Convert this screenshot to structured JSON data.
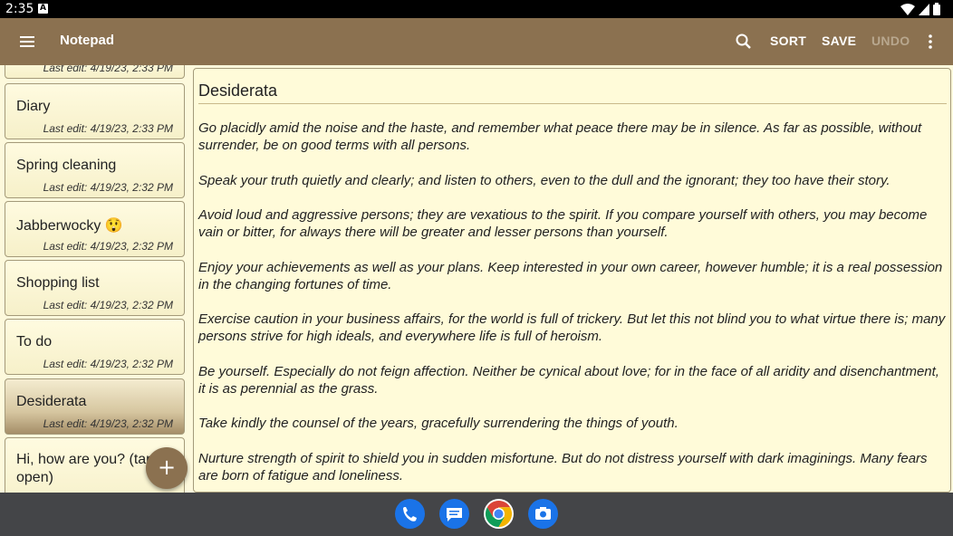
{
  "status_bar": {
    "time": "2:35",
    "indicator": "A"
  },
  "app_bar": {
    "title": "Notepad",
    "actions": {
      "sort": "SORT",
      "save": "SAVE",
      "undo": "UNDO"
    },
    "icons": [
      "menu-icon",
      "search-icon",
      "overflow-menu-icon"
    ]
  },
  "note_list": {
    "top_partial_date": "Last edit: 4/19/23, 2:33 PM",
    "items": [
      {
        "title": "Diary",
        "date": "Last edit: 4/19/23, 2:33 PM",
        "selected": false
      },
      {
        "title": "Spring cleaning",
        "date": "Last edit: 4/19/23, 2:32 PM",
        "selected": false
      },
      {
        "title": "Jabberwocky 😲",
        "date": "Last edit: 4/19/23, 2:32 PM",
        "selected": false
      },
      {
        "title": "Shopping list",
        "date": "Last edit: 4/19/23, 2:32 PM",
        "selected": false
      },
      {
        "title": "To do",
        "date": "Last edit: 4/19/23, 2:32 PM",
        "selected": false
      },
      {
        "title": "Desiderata",
        "date": "Last edit: 4/19/23, 2:32 PM",
        "selected": true
      },
      {
        "title": "Hi, how are you? (tap to open)",
        "date": "",
        "selected": false
      }
    ]
  },
  "fab": {
    "label": "+"
  },
  "editor": {
    "title": "Desiderata",
    "paragraphs": [
      "Go placidly amid the noise and the haste, and remember what peace there may be in silence. As far as possible, without surrender, be on good terms with all persons.",
      "Speak your truth quietly and clearly; and listen to others, even to the dull and the ignorant; they too have their story.",
      "Avoid loud and aggressive persons; they are vexatious to the spirit. If you compare yourself with others, you may become vain or bitter, for always there will be greater and lesser persons than yourself.",
      "Enjoy your achievements as well as your plans. Keep interested in your own career, however humble; it is a real possession in the changing fortunes of time.",
      "Exercise caution in your business affairs, for the world is full of trickery. But let this not blind you to what virtue there is; many persons strive for high ideals, and everywhere life is full of heroism.",
      "Be yourself. Especially do not feign affection. Neither be cynical about love; for in the face of all aridity and disenchantment, it is as perennial as the grass.",
      "Take kindly the counsel of the years, gracefully surrendering the things of youth.",
      "Nurture strength of spirit to shield you in sudden misfortune. But do not distress yourself with dark imaginings. Many fears are born of fatigue and loneliness."
    ]
  },
  "dock": {
    "apps": [
      "phone-icon",
      "messages-icon",
      "chrome-icon",
      "camera-icon"
    ]
  },
  "colors": {
    "app_bar": "#8b7150",
    "paper": "#fffbd9",
    "accent_disabled": "#b8a78e",
    "nav_bar": "#444548"
  }
}
